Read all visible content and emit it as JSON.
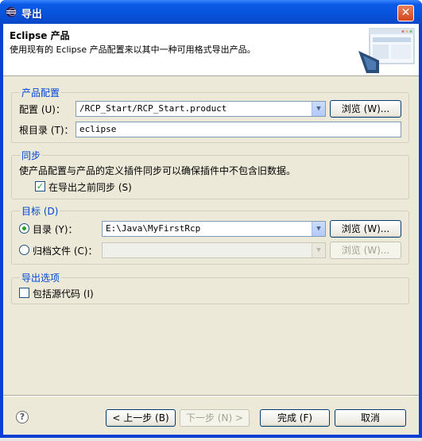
{
  "window": {
    "title": "导出"
  },
  "banner": {
    "title": "Eclipse 产品",
    "description": "使用现有的 Eclipse 产品配置来以其中一种可用格式导出产品。"
  },
  "product_config": {
    "group_title": "产品配置",
    "config_label": "配置 (U)：",
    "config_value": "/RCP_Start/RCP_Start.product",
    "browse_label": "浏览 (W)...",
    "root_label": "根目录 (T)：",
    "root_value": "eclipse"
  },
  "sync": {
    "group_title": "同步",
    "description": "使产品配置与产品的定义插件同步可以确保插件中不包含旧数据。",
    "checkbox_label": "在导出之前同步 (S)",
    "checked": true
  },
  "destination": {
    "group_title": "目标 (D)",
    "dir_label": "目录 (Y)：",
    "dir_value": "E:\\Java\\MyFirstRcp",
    "dir_browse_label": "浏览 (W)...",
    "archive_label": "归档文件 (C)：",
    "archive_value": "",
    "archive_browse_label": "浏览 (W)...",
    "selected": "directory"
  },
  "export_options": {
    "group_title": "导出选项",
    "include_source_label": "包括源代码 (I)",
    "checked": false
  },
  "footer": {
    "back_label": "< 上一步 (B)",
    "next_label": "下一步 (N) >",
    "finish_label": "完成 (F)",
    "cancel_label": "取消"
  },
  "colors": {
    "title_bar": "#0753dc",
    "group_title": "#0046d5",
    "client_bg": "#ece9d8"
  }
}
